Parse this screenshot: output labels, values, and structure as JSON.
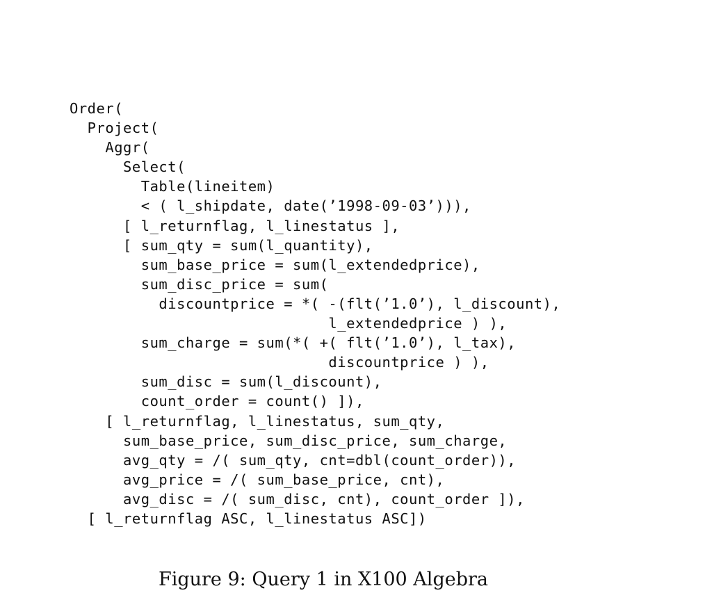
{
  "code": {
    "lines": [
      "Order(",
      "  Project(",
      "    Aggr(",
      "      Select(",
      "        Table(lineitem)",
      "        < ( l_shipdate, date(’1998-09-03’))),",
      "      [ l_returnflag, l_linestatus ],",
      "      [ sum_qty = sum(l_quantity),",
      "        sum_base_price = sum(l_extendedprice),",
      "        sum_disc_price = sum(",
      "          discountprice = *( -(flt(’1.0’), l_discount),",
      "                             l_extendedprice ) ),",
      "        sum_charge = sum(*( +( flt(’1.0’), l_tax),",
      "                             discountprice ) ),",
      "        sum_disc = sum(l_discount),",
      "        count_order = count() ]),",
      "    [ l_returnflag, l_linestatus, sum_qty,",
      "      sum_base_price, sum_disc_price, sum_charge,",
      "      avg_qty = /( sum_qty, cnt=dbl(count_order)),",
      "      avg_price = /( sum_base_price, cnt),",
      "      avg_disc = /( sum_disc, cnt), count_order ]),",
      "  [ l_returnflag ASC, l_linestatus ASC])"
    ]
  },
  "caption": "Figure 9: Query 1 in X100 Algebra"
}
